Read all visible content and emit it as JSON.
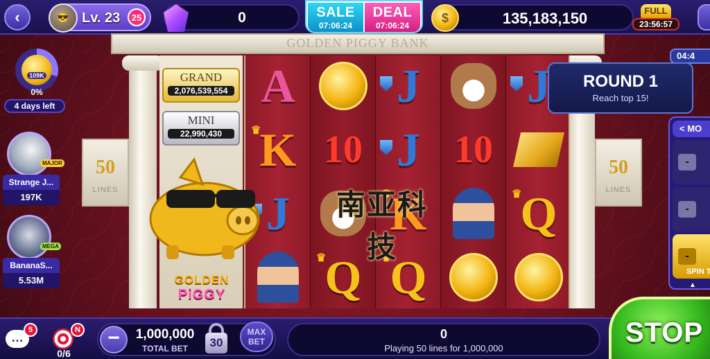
{
  "header": {
    "level": "Lv. 23",
    "level_badge": "25",
    "gems": "0",
    "sale": {
      "label": "SALE",
      "timer": "07:06:24"
    },
    "deal": {
      "label": "DEAL",
      "timer": "07:06:24"
    },
    "coins": "135,183,150",
    "piggy_bank": {
      "label": "FULL",
      "timer": "23:56:57"
    }
  },
  "left_sidebar": {
    "coin_goal": "109K",
    "progress_percent": "0%",
    "progress_value": 0,
    "days_left": "4 days left",
    "players": [
      {
        "name": "Strange J...",
        "score": "197K",
        "badge": "MAJOR"
      },
      {
        "name": "BananaS...",
        "score": "5.53M",
        "badge": "MEGA"
      }
    ]
  },
  "machine": {
    "title": "GOLDEN PIGGY BANK",
    "lines_count": "50",
    "lines_label": "LINES",
    "jackpots": [
      {
        "name": "GRAND",
        "value": "2,076,539,554"
      },
      {
        "name": "MINI",
        "value": "22,990,430"
      }
    ],
    "logo": {
      "line1": "GOLDEN",
      "line2": "PiGGY"
    },
    "watermark": "南亚科技",
    "reels": [
      [
        "A",
        "K",
        "J",
        "cop"
      ],
      [
        "coin",
        "10",
        "dog",
        "Q"
      ],
      [
        "J",
        "J",
        "K",
        "Q"
      ],
      [
        "dog",
        "10",
        "cop",
        "coin"
      ],
      [
        "J",
        "bar",
        "Q",
        "coin"
      ]
    ]
  },
  "tournament": {
    "timer": "04:4",
    "round_title": "ROUND 1",
    "round_subtitle": "Reach top 15!",
    "more_label": "< MO",
    "row_dash": "-",
    "spin_label": "SPIN T"
  },
  "footer": {
    "chat_badge": "5",
    "target_badge": "N",
    "target_count": "0/6",
    "total_bet": "1,000,000",
    "total_bet_label": "TOTAL BET",
    "lock_level": "30",
    "max_bet_label": "MAX BET",
    "win_value": "0",
    "win_subtitle": "Playing 50 lines for 1,000,000",
    "stop_label": "STOP"
  }
}
